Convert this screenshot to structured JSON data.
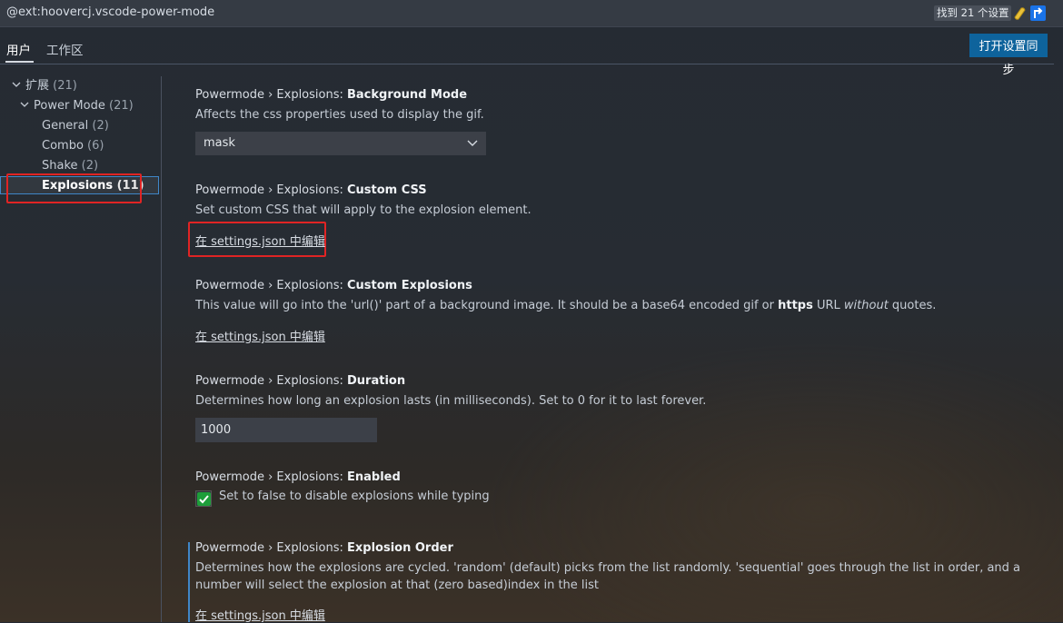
{
  "search": {
    "query": "@ext:hoovercj.vscode-power-mode",
    "result_count": "找到 21 个设置",
    "filter_icon": "filter-icon",
    "clear_icon": "clear-filter-icon"
  },
  "tabs": {
    "user": "用户",
    "workspace": "工作区",
    "sync_button": "打开设置同步"
  },
  "tree": {
    "extensions": {
      "label": "扩展",
      "count": "(21)"
    },
    "power_mode": {
      "label": "Power Mode",
      "count": "(21)"
    },
    "general": {
      "label": "General",
      "count": "(2)"
    },
    "combo": {
      "label": "Combo",
      "count": "(6)"
    },
    "shake": {
      "label": "Shake",
      "count": "(2)"
    },
    "explosions": {
      "label": "Explosions",
      "count": "(11)"
    }
  },
  "settings": {
    "background_mode": {
      "prefix": "Powermode › Explosions: ",
      "name": "Background Mode",
      "description": "Affects the css properties used to display the gif.",
      "value": "mask"
    },
    "custom_css": {
      "prefix": "Powermode › Explosions: ",
      "name": "Custom CSS",
      "description": "Set custom CSS that will apply to the explosion element.",
      "link": "在 settings.json 中编辑"
    },
    "custom_explosions": {
      "prefix": "Powermode › Explosions: ",
      "name": "Custom Explosions",
      "desc_a": "This value will go into the 'url()' part of a background image. It should be a base64 encoded gif or ",
      "desc_b": "https",
      "desc_c": " URL ",
      "desc_d": "without",
      "desc_e": " quotes.",
      "link": "在 settings.json 中编辑"
    },
    "duration": {
      "prefix": "Powermode › Explosions: ",
      "name": "Duration",
      "description": "Determines how long an explosion lasts (in milliseconds). Set to 0 for it to last forever.",
      "value": "1000"
    },
    "enabled": {
      "prefix": "Powermode › Explosions: ",
      "name": "Enabled",
      "checkbox_label": "Set to false to disable explosions while typing",
      "checked": true
    },
    "explosion_order": {
      "prefix": "Powermode › Explosions: ",
      "name": "Explosion Order",
      "description": "Determines how the explosions are cycled. 'random' (default) picks from the list randomly. 'sequential' goes through the list in order, and a number will select the explosion at that (zero based)index in the list",
      "link": "在 settings.json 中编辑"
    }
  },
  "colors": {
    "accent": "#0e639c",
    "highlight_box": "#e02424",
    "checkbox_green": "#1e9e3a"
  }
}
